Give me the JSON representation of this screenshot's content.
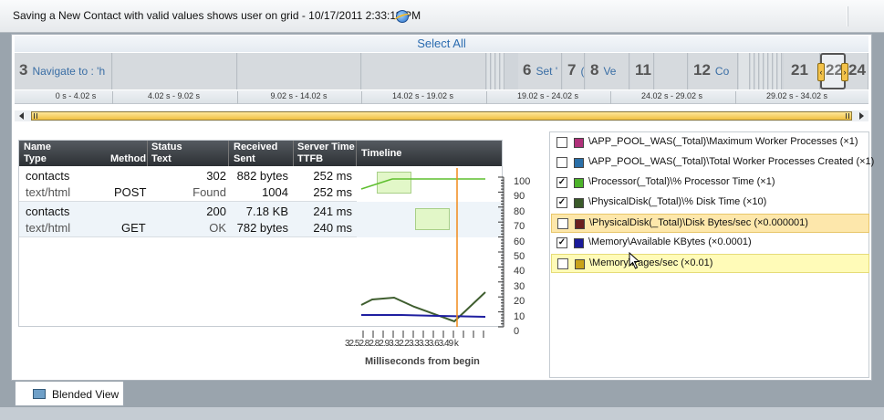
{
  "window": {
    "title": "Saving a New Contact with valid values shows user on grid - 10/17/2011 2:33:11 PM"
  },
  "toolbar": {
    "select_all": "Select All"
  },
  "steps": [
    {
      "num": "3",
      "label": "Navigate to : 'h"
    },
    {
      "num": "6",
      "label": "Set '"
    },
    {
      "num": "7",
      "label": "("
    },
    {
      "num": "8",
      "label": "Ve"
    },
    {
      "num": "11",
      "label": ""
    },
    {
      "num": "12",
      "label": "Co"
    },
    {
      "num": "21",
      "label": ""
    },
    {
      "num": "22",
      "label": ""
    },
    {
      "num": "24",
      "label": ""
    }
  ],
  "time_ranges": [
    "0 s - 4.02 s",
    "4.02 s - 9.02 s",
    "9.02 s - 14.02 s",
    "14.02 s - 19.02 s",
    "19.02 s - 24.02 s",
    "24.02 s - 29.02 s",
    "29.02 s - 34.02 s"
  ],
  "table": {
    "headers": {
      "name": "Name",
      "type": "Type",
      "method": "Method",
      "status": "Status",
      "text": "Text",
      "received": "Received",
      "sent": "Sent",
      "server_time": "Server Time",
      "ttfb": "TTFB",
      "timeline": "Timeline"
    },
    "rows": [
      {
        "name": "contacts",
        "type": "text/html",
        "method": "POST",
        "status": "302",
        "text": "Found",
        "received": "882 bytes",
        "sent": "1004",
        "server_time": "252 ms",
        "ttfb": "252 ms"
      },
      {
        "name": "contacts",
        "type": "text/html",
        "method": "GET",
        "status": "200",
        "text": "OK",
        "received": "7.18 KB",
        "sent": "782 bytes",
        "server_time": "241 ms",
        "ttfb": "240 ms"
      }
    ]
  },
  "chart": {
    "y_ticks": [
      "100",
      "90",
      "80",
      "70",
      "60",
      "50",
      "40",
      "30",
      "20",
      "10",
      "0"
    ],
    "x_ticks": "32.52.82.82.93.32.23.33.33.63.49 k",
    "x_label": "Milliseconds from begin"
  },
  "counters": [
    {
      "checked": false,
      "color": "#b0307a",
      "label": "\\APP_POOL_WAS(_Total)\\Maximum Worker Processes (×1)",
      "highlight": ""
    },
    {
      "checked": false,
      "color": "#2a6fa8",
      "label": "\\APP_POOL_WAS(_Total)\\Total Worker Processes Created (×1)",
      "highlight": ""
    },
    {
      "checked": true,
      "color": "#4cb32a",
      "label": "\\Processor(_Total)\\% Processor Time (×1)",
      "highlight": ""
    },
    {
      "checked": true,
      "color": "#3a5a2a",
      "label": "\\PhysicalDisk(_Total)\\% Disk Time (×10)",
      "highlight": ""
    },
    {
      "checked": false,
      "color": "#6b1f1f",
      "label": "\\PhysicalDisk(_Total)\\Disk Bytes/sec (×0.000001)",
      "highlight": "hl"
    },
    {
      "checked": true,
      "color": "#1a1a9a",
      "label": "\\Memory\\Available KBytes (×0.0001)",
      "highlight": ""
    },
    {
      "checked": false,
      "color": "#c9a21a",
      "label": "\\Memory\\Pages/sec (×0.01)",
      "highlight": "hl2"
    }
  ],
  "tabs": {
    "blended": "Blended View"
  }
}
